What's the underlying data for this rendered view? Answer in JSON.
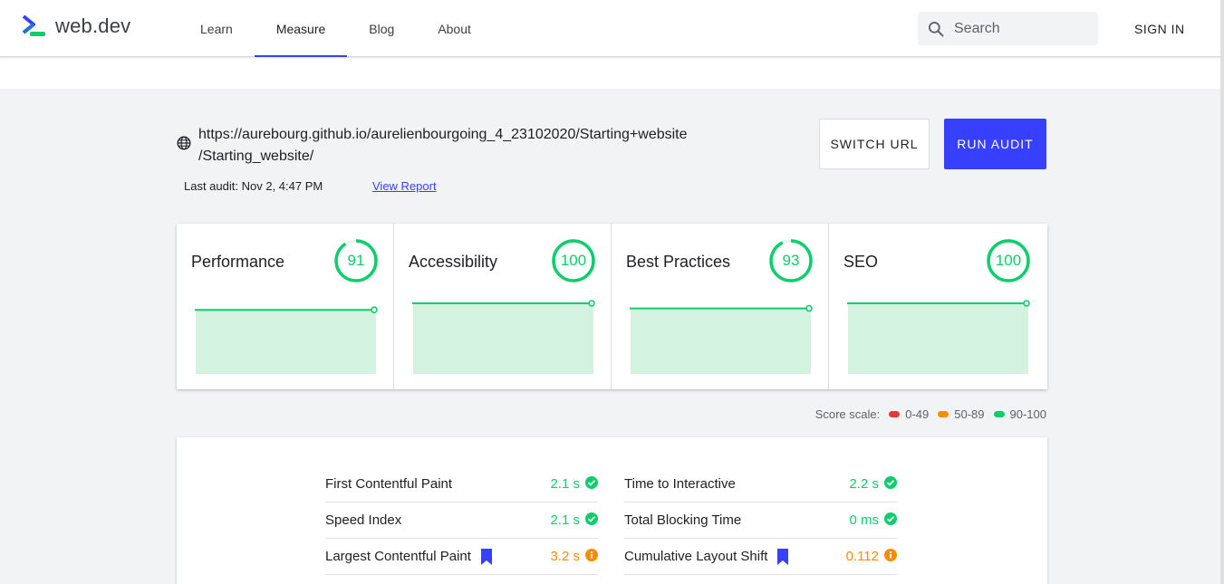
{
  "header": {
    "logo_text": "web.dev",
    "nav": [
      "Learn",
      "Measure",
      "Blog",
      "About"
    ],
    "active_nav": "Measure",
    "search_placeholder": "Search",
    "signin": "SIGN IN"
  },
  "audit": {
    "url_line1": "https://aurebourg.github.io/aurelienbourgoing_4_23102020/Starting+website",
    "url_line2": "/Starting_website/",
    "last_audit": "Last audit: Nov 2, 4:47 PM",
    "view_report": "View Report",
    "switch_url": "SWITCH URL",
    "run_audit": "RUN AUDIT"
  },
  "scores": [
    {
      "label": "Performance",
      "value": 91
    },
    {
      "label": "Accessibility",
      "value": 100
    },
    {
      "label": "Best Practices",
      "value": 93
    },
    {
      "label": "SEO",
      "value": 100
    }
  ],
  "score_scale": {
    "label": "Score scale:",
    "ranges": [
      {
        "text": "0-49",
        "color": "#e53935"
      },
      {
        "text": "50-89",
        "color": "#fb8c00"
      },
      {
        "text": "90-100",
        "color": "#0cce6b"
      }
    ]
  },
  "metrics": [
    {
      "label": "First Contentful Paint",
      "value": "2.1 s",
      "status": "pass",
      "bookmark": false
    },
    {
      "label": "Time to Interactive",
      "value": "2.2 s",
      "status": "pass",
      "bookmark": false
    },
    {
      "label": "Speed Index",
      "value": "2.1 s",
      "status": "pass",
      "bookmark": false
    },
    {
      "label": "Total Blocking Time",
      "value": "0 ms",
      "status": "pass",
      "bookmark": false
    },
    {
      "label": "Largest Contentful Paint",
      "value": "3.2 s",
      "status": "average",
      "bookmark": true
    },
    {
      "label": "Cumulative Layout Shift",
      "value": "0.112",
      "status": "average",
      "bookmark": true
    }
  ],
  "colors": {
    "accent": "#3740ff",
    "pass": "#0cce6b",
    "average": "#fb8c00",
    "fail": "#e53935"
  }
}
